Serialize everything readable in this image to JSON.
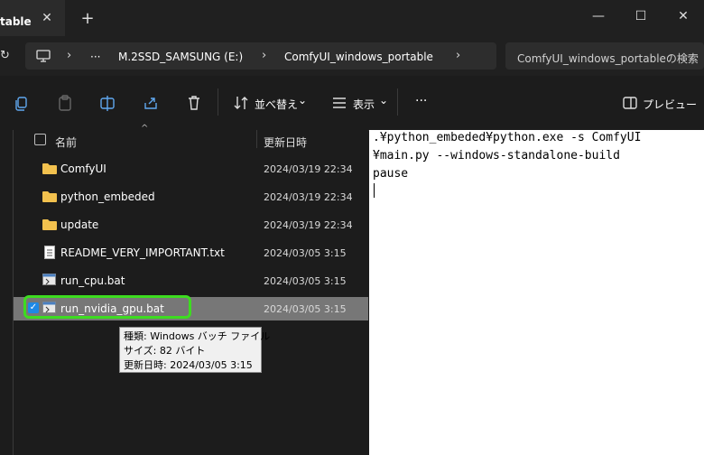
{
  "tab": {
    "title": "table",
    "close_glyph": "✕",
    "new_glyph": "+"
  },
  "window_controls": {
    "minimize": "—",
    "maximize": "☐",
    "close": "✕"
  },
  "address": {
    "refresh_glyph": "↻",
    "more": "···",
    "crumbs": [
      "M.2SSD_SAMSUNG (E:)",
      "ComfyUI_windows_portable"
    ],
    "chevron": "›"
  },
  "search": {
    "placeholder": "ComfyUI_windows_portableの検索"
  },
  "toolbar": {
    "sort_label": "並べ替え",
    "view_label": "表示",
    "more": "···",
    "preview_label": "プレビュー",
    "dropdown": "⌄"
  },
  "columns": {
    "name": "名前",
    "date": "更新日時",
    "sort_glyph": "^"
  },
  "files": [
    {
      "name": "ComfyUI",
      "date": "2024/03/19 22:34",
      "type": "folder"
    },
    {
      "name": "python_embeded",
      "date": "2024/03/19 22:34",
      "type": "folder"
    },
    {
      "name": "update",
      "date": "2024/03/19 22:34",
      "type": "folder"
    },
    {
      "name": "README_VERY_IMPORTANT.txt",
      "date": "2024/03/05 3:15",
      "type": "txt"
    },
    {
      "name": "run_cpu.bat",
      "date": "2024/03/05 3:15",
      "type": "bat"
    },
    {
      "name": "run_nvidia_gpu.bat",
      "date": "2024/03/05 3:15",
      "type": "bat",
      "selected": true
    }
  ],
  "tooltip": {
    "type_line": "種類: Windows バッチ ファイル",
    "size_line": "サイズ: 82 バイト",
    "date_line": "更新日時: 2024/03/05 3:15"
  },
  "preview": {
    "lines": [
      ".¥python_embeded¥python.exe -s ComfyUI",
      "¥main.py --windows-standalone-build",
      "pause"
    ]
  },
  "colors": {
    "highlight": "#3ddc20",
    "selected_row": "#777777",
    "accent": "#1e88e5"
  }
}
